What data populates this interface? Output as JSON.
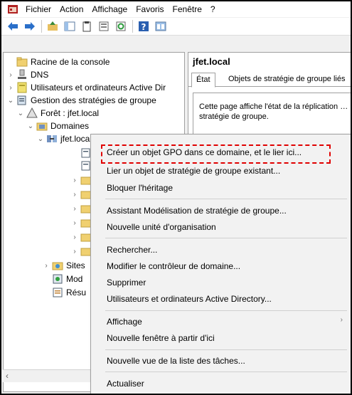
{
  "menubar": {
    "items": [
      "Fichier",
      "Action",
      "Affichage",
      "Favoris",
      "Fenêtre",
      "?"
    ]
  },
  "toolbar": {
    "buttons": [
      "back-arrow-icon",
      "forward-arrow-icon",
      "folder-up-icon",
      "console-tree-icon",
      "clipboard-icon",
      "properties-icon",
      "refresh-icon",
      "help-icon",
      "mmc-view-icon"
    ]
  },
  "tree": {
    "root": "Racine de la console",
    "dns": "DNS",
    "users": "Utilisateurs et ordinateurs Active Dir",
    "gpm": "Gestion des stratégies de groupe",
    "forest": "Forêt : jfet.local",
    "domains": "Domaines",
    "domain": "jfet.local",
    "sites": "Sites",
    "mod": "Mod",
    "res": "Résu"
  },
  "right": {
    "title": "jfet.local",
    "tab_status": "État",
    "tab_gpo": "Objets de stratégie de groupe liés",
    "status_text": "Cette page affiche l'état de la réplication … stratégie de groupe."
  },
  "context_menu": {
    "create_gpo": "Créer un objet GPO dans ce domaine, et le lier ici...",
    "link_gpo": "Lier un objet de stratégie de groupe existant...",
    "block": "Bloquer l'héritage",
    "wizard": "Assistant Modélisation de stratégie de groupe...",
    "new_ou": "Nouvelle unité d'organisation",
    "search": "Rechercher...",
    "change_dc": "Modifier le contrôleur de domaine...",
    "delete": "Supprimer",
    "aduc": "Utilisateurs et ordinateurs Active Directory...",
    "view": "Affichage",
    "new_window": "Nouvelle fenêtre à partir d'ici",
    "new_taskpad": "Nouvelle vue de la liste des tâches...",
    "refresh": "Actualiser"
  },
  "colors": {
    "highlight_border": "#e00000",
    "menu_bg": "#f2f2f2"
  }
}
